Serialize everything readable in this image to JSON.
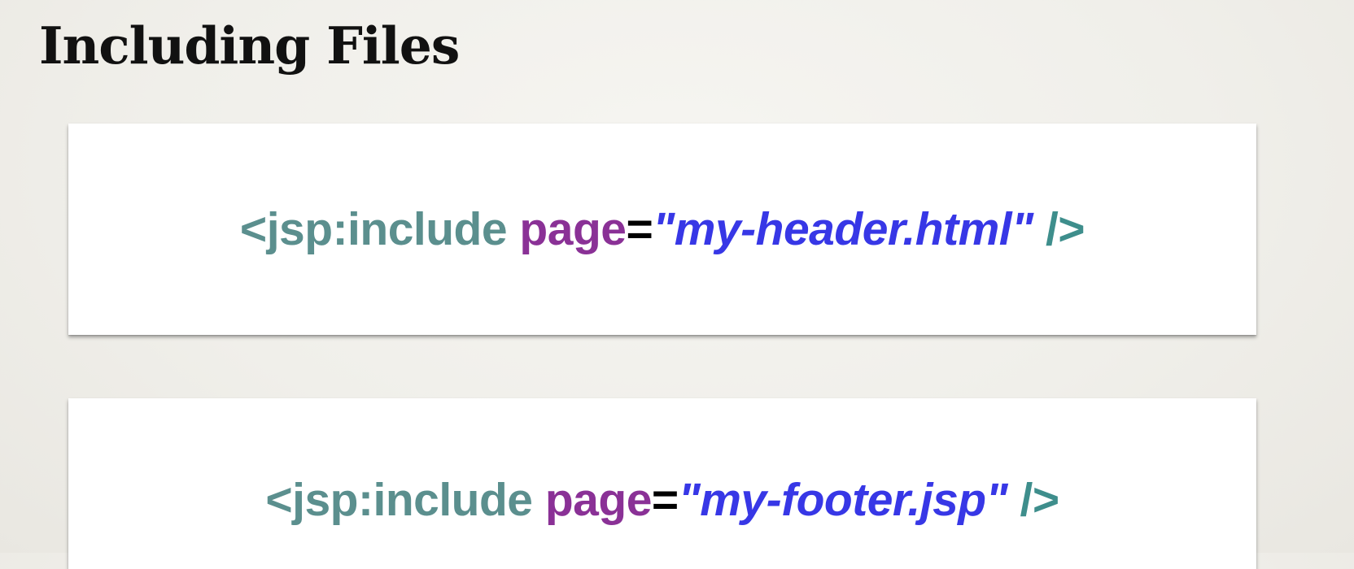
{
  "slide": {
    "title": "Including Files"
  },
  "code_blocks": [
    {
      "tag_open": "<jsp:include",
      "attribute": "page",
      "equals": "=",
      "value": "\"my-header.html\"",
      "tag_close": "/>"
    },
    {
      "tag_open": "<jsp:include",
      "attribute": "page",
      "equals": "=",
      "value": "\"my-footer.jsp\"",
      "tag_close": "/>"
    }
  ],
  "colors": {
    "tag": "#5b8f8e",
    "attribute": "#8a3196",
    "equals": "#000000",
    "value": "#3737e6",
    "background": "#f0efea",
    "card": "#ffffff"
  }
}
